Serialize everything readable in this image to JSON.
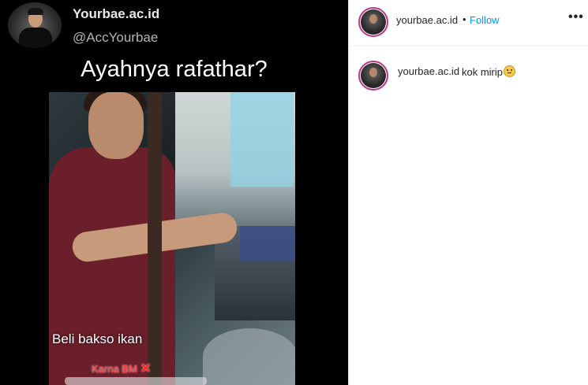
{
  "post_media": {
    "twitter_name": "Yourbae.ac.id",
    "twitter_handle": "@AccYourbae",
    "caption": "Ayahnya rafathar?",
    "video_subtitle_1": "Beli bakso ikan",
    "video_subtitle_2": "Karna BM",
    "video_subtitle_2_mark": "✕"
  },
  "sidebar": {
    "username": "yourbae.ac.id",
    "separator": "•",
    "follow_label": "Follow",
    "more_label": "•••",
    "comment": {
      "username": "yourbae.ac.id",
      "text": "kok mirip",
      "emoji": "flushed-face-emoji"
    }
  },
  "colors": {
    "follow_blue": "#0095f6",
    "story_ring": "#c13584",
    "text_dark": "#262626"
  }
}
